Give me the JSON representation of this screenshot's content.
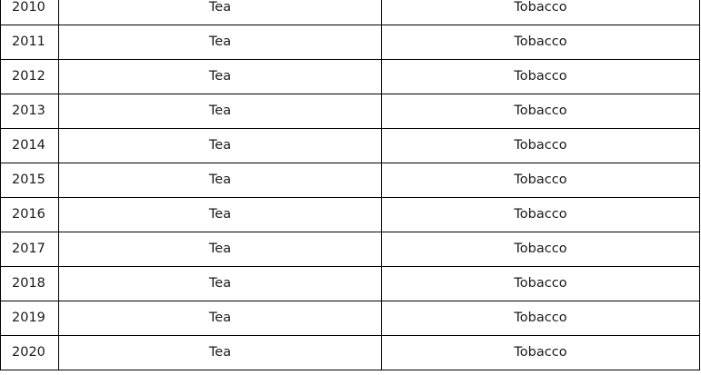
{
  "table": {
    "rows": [
      {
        "year": "2010",
        "col_a": "Tea",
        "col_b": "Tobacco"
      },
      {
        "year": "2011",
        "col_a": "Tea",
        "col_b": "Tobacco"
      },
      {
        "year": "2012",
        "col_a": "Tea",
        "col_b": "Tobacco"
      },
      {
        "year": "2013",
        "col_a": "Tea",
        "col_b": "Tobacco"
      },
      {
        "year": "2014",
        "col_a": "Tea",
        "col_b": "Tobacco"
      },
      {
        "year": "2015",
        "col_a": "Tea",
        "col_b": "Tobacco"
      },
      {
        "year": "2016",
        "col_a": "Tea",
        "col_b": "Tobacco"
      },
      {
        "year": "2017",
        "col_a": "Tea",
        "col_b": "Tobacco"
      },
      {
        "year": "2018",
        "col_a": "Tea",
        "col_b": "Tobacco"
      },
      {
        "year": "2019",
        "col_a": "Tea",
        "col_b": "Tobacco"
      },
      {
        "year": "2020",
        "col_a": "Tea",
        "col_b": "Tobacco"
      }
    ]
  },
  "colors": {
    "border": "#000000",
    "text": "#1a1a1a",
    "background": "#ffffff"
  }
}
